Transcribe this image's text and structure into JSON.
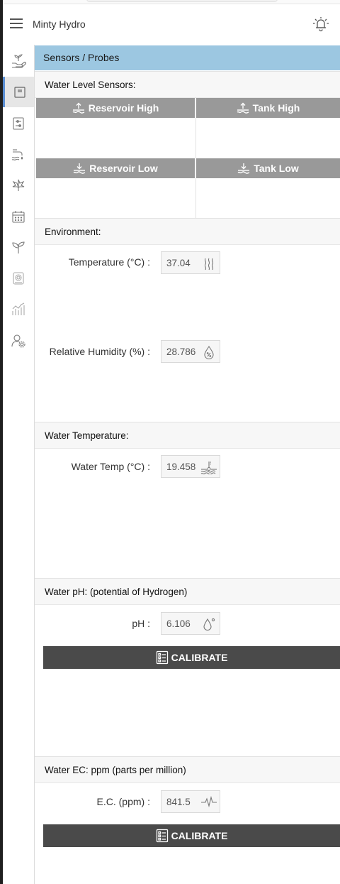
{
  "app": {
    "title": "Minty Hydro"
  },
  "page": {
    "title": "Sensors / Probes"
  },
  "sidebar": {
    "items": [
      {
        "icon": "plant-hand-icon"
      },
      {
        "icon": "sensor-probe-icon",
        "active": true
      },
      {
        "icon": "controls-icon"
      },
      {
        "icon": "water-pump-icon"
      },
      {
        "icon": "leaf-icon"
      },
      {
        "icon": "calendar-icon"
      },
      {
        "icon": "sprout-icon"
      },
      {
        "icon": "device-icon"
      },
      {
        "icon": "chart-icon"
      },
      {
        "icon": "user-settings-icon"
      }
    ]
  },
  "water_level": {
    "title": "Water Level Sensors:",
    "reservoir_high": "Reservoir High",
    "tank_high": "Tank High",
    "reservoir_low": "Reservoir Low",
    "tank_low": "Tank Low"
  },
  "environment": {
    "title": "Environment:",
    "temperature_label": "Temperature (°C) :",
    "temperature_value": "37.04",
    "humidity_label": "Relative Humidity (%) :",
    "humidity_value": "28.786"
  },
  "water_temperature": {
    "title": "Water Temperature:",
    "label": "Water Temp (°C) :",
    "value": "19.458"
  },
  "ph": {
    "title": "Water pH: (potential of Hydrogen)",
    "label": "pH :",
    "value": "6.106",
    "calibrate_label": "CALIBRATE"
  },
  "ec": {
    "title": "Water EC: ppm (parts per million)",
    "label": "E.C. (ppm) :",
    "value": "841.5",
    "calibrate_label": "CALIBRATE"
  },
  "colors": {
    "page_bar": "#9cc7e1",
    "level_header": "#999999",
    "calibrate_button": "#4a4a4a",
    "active_indicator": "#5b8fd4"
  }
}
